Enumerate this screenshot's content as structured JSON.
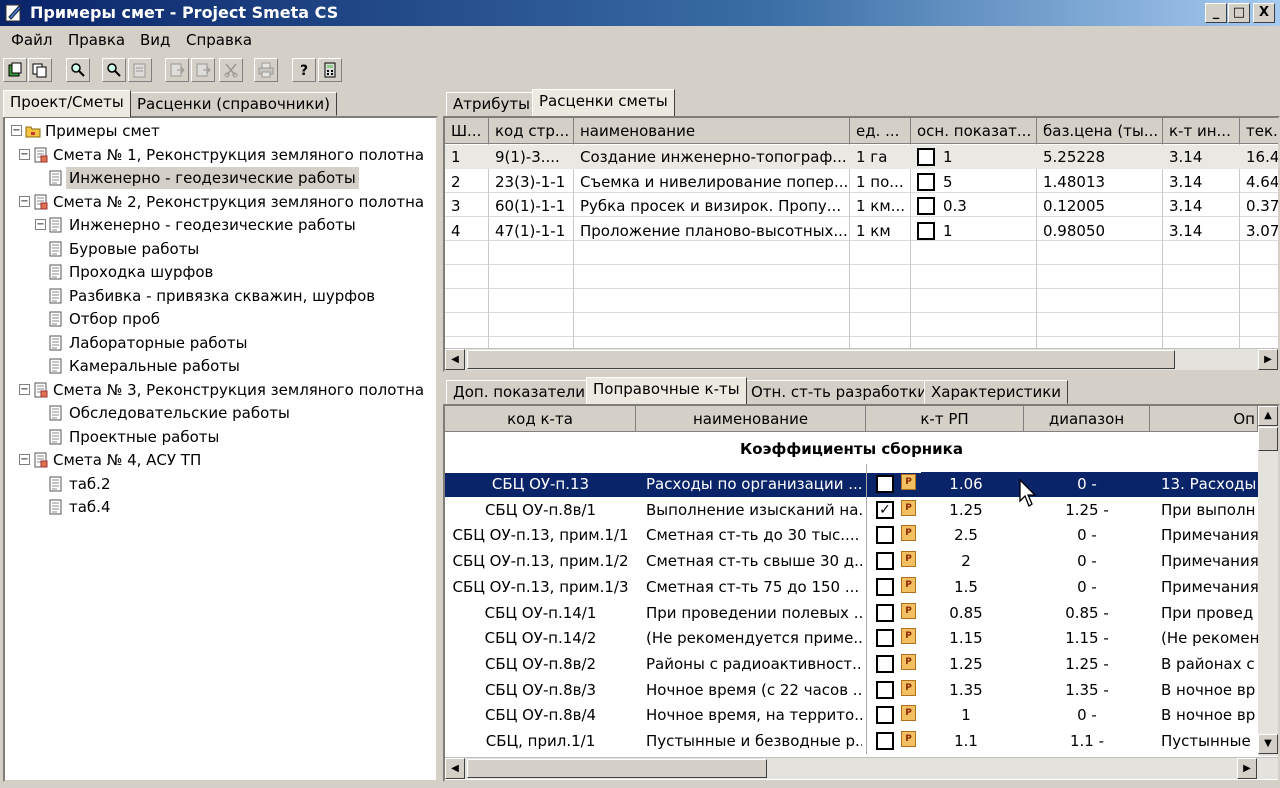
{
  "window": {
    "title": "Примеры смет - Project Smeta CS",
    "min": "_",
    "max": "□",
    "close": "X"
  },
  "menu": [
    "Файл",
    "Правка",
    "Вид",
    "Справка"
  ],
  "left_tabs": [
    "Проект/Сметы",
    "Расценки (справочники)"
  ],
  "tree": [
    {
      "label": "Примеры смет",
      "level": 0,
      "expander": "⊟",
      "icon": "folder-icon"
    },
    {
      "label": "Смета № 1, Реконструкция земляного полотна",
      "level": 1,
      "expander": "⊟",
      "icon": "estimate-icon"
    },
    {
      "label": "Инженерно - геодезические работы",
      "level": 2,
      "icon": "doc-icon",
      "selected": true
    },
    {
      "label": "Смета № 2, Реконструкция земляного полотна",
      "level": 1,
      "expander": "⊟",
      "icon": "estimate-icon"
    },
    {
      "label": "Инженерно - геодезические работы",
      "level": 2,
      "expander": "⊟",
      "icon": "doc-icon"
    },
    {
      "label": "Буровые работы",
      "level": 3,
      "icon": "doc-icon"
    },
    {
      "label": "Проходка шурфов",
      "level": 3,
      "icon": "doc-icon"
    },
    {
      "label": "Разбивка - привязка скважин, шурфов",
      "level": 3,
      "icon": "doc-icon"
    },
    {
      "label": "Отбор проб",
      "level": 3,
      "icon": "doc-icon"
    },
    {
      "label": "Лабораторные работы",
      "level": 3,
      "icon": "doc-icon"
    },
    {
      "label": "Камеральные работы",
      "level": 3,
      "icon": "doc-icon"
    },
    {
      "label": "Смета № 3, Реконструкция земляного полотна",
      "level": 1,
      "expander": "⊟",
      "icon": "estimate-icon"
    },
    {
      "label": "Обследовательские работы",
      "level": 2,
      "icon": "doc-icon"
    },
    {
      "label": "Проектные работы",
      "level": 2,
      "icon": "doc-icon"
    },
    {
      "label": "Смета № 4, АСУ ТП",
      "level": 1,
      "expander": "⊟",
      "icon": "estimate-icon"
    },
    {
      "label": "таб.2",
      "level": 2,
      "icon": "doc-icon"
    },
    {
      "label": "таб.4",
      "level": 2,
      "icon": "doc-icon"
    }
  ],
  "top_tabs": [
    "Атрибуты",
    "Расценки сметы"
  ],
  "rates_table": {
    "headers": [
      "Ш...",
      "код стр...",
      "наименование",
      "ед. ...",
      "осн. показат...",
      "баз.цена (ты...",
      "к-т ин...",
      "тек..."
    ],
    "rows": [
      [
        "1",
        "9(1)-3....",
        "Создание инженерно-топограф...",
        "1 га",
        "1",
        "5.25228",
        "3.14",
        "16.4"
      ],
      [
        "2",
        "23(3)-1-1",
        "Съемка и нивелирование попер...",
        "1 по...",
        "5",
        "1.48013",
        "3.14",
        "4.64"
      ],
      [
        "3",
        "60(1)-1-1",
        "Рубка просек и визирок. Пропу...",
        "1 км...",
        "0.3",
        "0.12005",
        "3.14",
        "0.37"
      ],
      [
        "4",
        "47(1)-1-1",
        "Проложение планово-высотных...",
        "1 км",
        "1",
        "0.98050",
        "3.14",
        "3.07"
      ]
    ]
  },
  "bottom_tabs": [
    "Доп. показатели",
    "Поправочные к-ты",
    "Отн. ст-ть разработки",
    "Характеристики"
  ],
  "coef_table": {
    "headers": [
      "код к-та",
      "наименование",
      "к-т РП",
      "диапазон",
      "Оп"
    ],
    "group_title": "Коэффициенты сборника",
    "rows": [
      {
        "code": "СБЦ ОУ-п.13",
        "name": "Расходы по организации ...",
        "checked": true,
        "value": "1.06",
        "range": "0 -",
        "desc": "13. Расходы"
      },
      {
        "code": "СБЦ ОУ-п.8в/1",
        "name": "Выполнение изысканий на...",
        "checked": true,
        "value": "1.25",
        "range": "1.25 -",
        "desc": "При выполн"
      },
      {
        "code": "СБЦ ОУ-п.13, прим.1/1",
        "name": "Сметная ст-ть до 30 тыс....",
        "checked": false,
        "value": "2.5",
        "range": "0 -",
        "desc": "Примечания"
      },
      {
        "code": "СБЦ ОУ-п.13, прим.1/2",
        "name": "Сметная ст-ть свыше 30 д...",
        "checked": false,
        "value": "2",
        "range": "0 -",
        "desc": "Примечания"
      },
      {
        "code": "СБЦ ОУ-п.13, прим.1/3",
        "name": "Сметная ст-ть 75 до 150 ...",
        "checked": false,
        "value": "1.5",
        "range": "0 -",
        "desc": "Примечания"
      },
      {
        "code": "СБЦ ОУ-п.14/1",
        "name": "При проведении полевых ...",
        "checked": false,
        "value": "0.85",
        "range": "0.85 -",
        "desc": "При провед"
      },
      {
        "code": "СБЦ ОУ-п.14/2",
        "name": "(Не рекомендуется приме...",
        "checked": false,
        "value": "1.15",
        "range": "1.15 -",
        "desc": "(Не рекомен"
      },
      {
        "code": "СБЦ ОУ-п.8в/2",
        "name": "Районы с радиоактивност...",
        "checked": false,
        "value": "1.25",
        "range": "1.25 -",
        "desc": "В районах с"
      },
      {
        "code": "СБЦ ОУ-п.8в/3",
        "name": "Ночное время (с 22 часов ...",
        "checked": false,
        "value": "1.35",
        "range": "1.35 -",
        "desc": "В ночное вр"
      },
      {
        "code": "СБЦ ОУ-п.8в/4",
        "name": "Ночное время, на террито...",
        "checked": false,
        "value": "1",
        "range": "0 -",
        "desc": "В ночное вр"
      },
      {
        "code": "СБЦ, прил.1/1",
        "name": "Пустынные и безводные р...",
        "checked": false,
        "value": "1.1",
        "range": "1.1 -",
        "desc": "Пустынные"
      }
    ]
  },
  "toolbar": [
    "new-icon",
    "copy-icon",
    "find-icon",
    "find-next-icon",
    "paste-icon",
    "export-icon",
    "export2-icon",
    "cut-icon",
    "print-icon",
    "help-icon",
    "calculator-icon"
  ],
  "colors": {
    "selection": "#0a246a",
    "face": "#d4d0c8",
    "title_start": "#0a246a"
  }
}
